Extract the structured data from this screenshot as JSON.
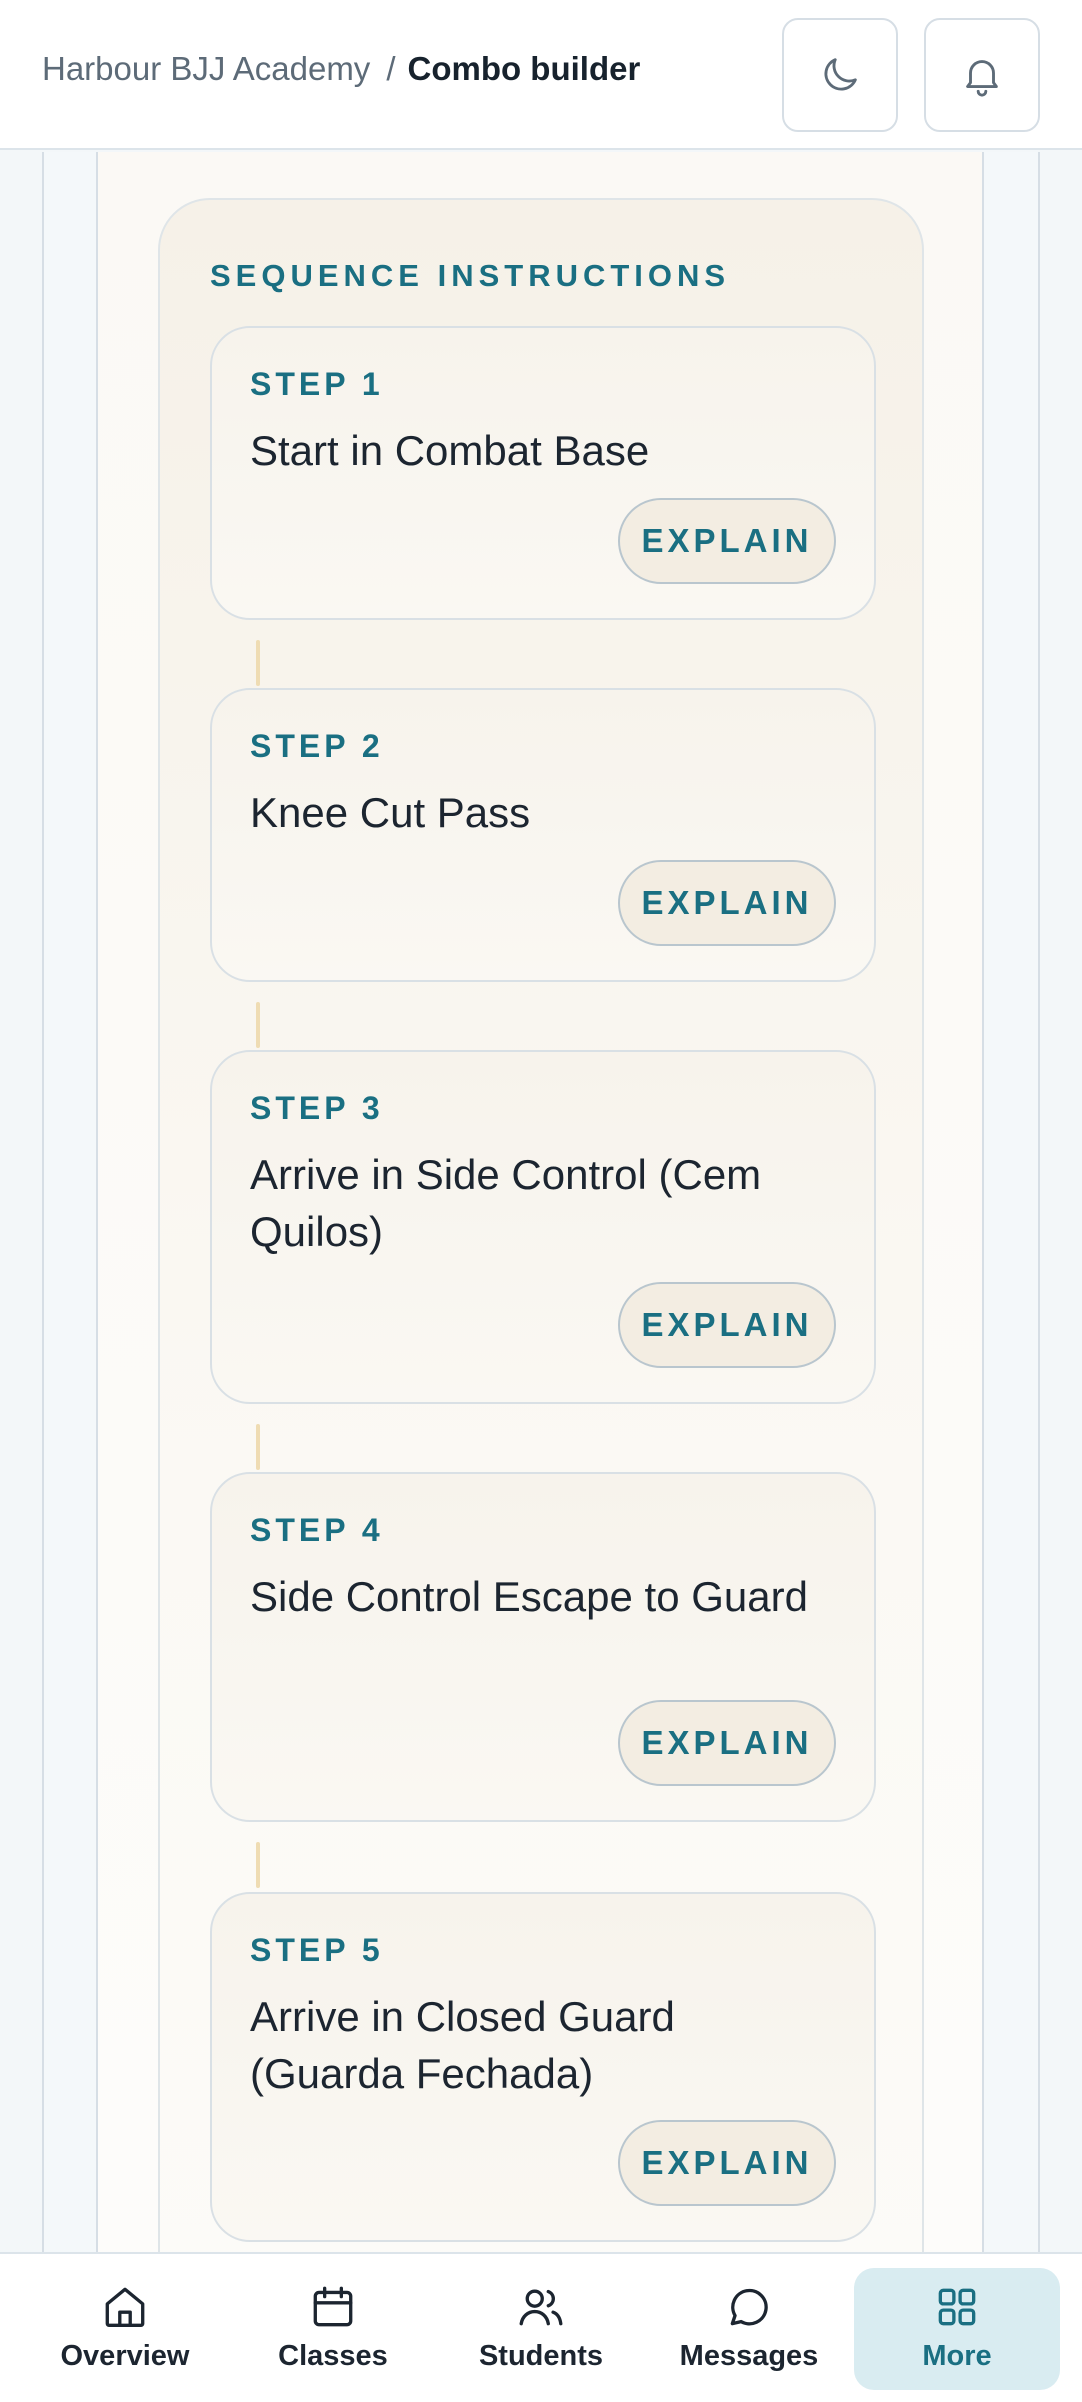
{
  "header": {
    "breadcrumb_parent": "Harbour BJJ Academy",
    "breadcrumb_separator": "/",
    "breadcrumb_current": "Combo builder",
    "theme_toggle_icon": "moon-icon",
    "notifications_icon": "bell-icon"
  },
  "sequence": {
    "title": "SEQUENCE INSTRUCTIONS",
    "explain_label": "EXPLAIN",
    "steps": [
      {
        "label": "STEP 1",
        "text": "Start in Combat Base"
      },
      {
        "label": "STEP 2",
        "text": "Knee Cut Pass"
      },
      {
        "label": "STEP 3",
        "text": "Arrive in Side Control (Cem Quilos)"
      },
      {
        "label": "STEP 4",
        "text": "Side Control Escape to Guard"
      },
      {
        "label": "STEP 5",
        "text": "Arrive in Closed Guard (Guarda Fechada)"
      }
    ]
  },
  "bottom_nav": {
    "items": [
      {
        "label": "Overview",
        "icon": "home-icon",
        "active": false
      },
      {
        "label": "Classes",
        "icon": "calendar-icon",
        "active": false
      },
      {
        "label": "Students",
        "icon": "users-icon",
        "active": false
      },
      {
        "label": "Messages",
        "icon": "message-icon",
        "active": false
      },
      {
        "label": "More",
        "icon": "grid-icon",
        "active": true
      }
    ]
  },
  "colors": {
    "accent": "#1a6f82",
    "active_nav_bg": "#d9ecf1",
    "connector": "#efdcb3"
  }
}
